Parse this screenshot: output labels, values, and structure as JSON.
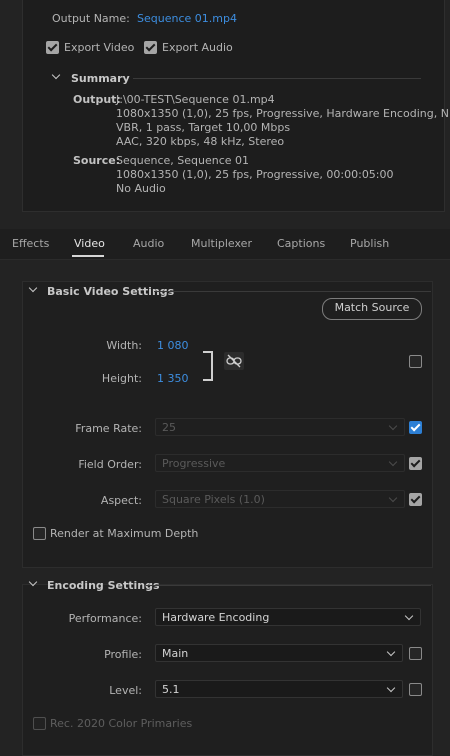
{
  "output": {
    "name_label": "Output Name:",
    "name_value": "Sequence 01.mp4",
    "export_video_label": "Export Video",
    "export_audio_label": "Export Audio",
    "export_video_checked": true,
    "export_audio_checked": true
  },
  "summary": {
    "title": "Summary",
    "output_label": "Output:",
    "output_lines": [
      "J:\\00-TEST\\Sequence 01.mp4",
      "1080x1350 (1,0), 25 fps, Progressive, Hardware Encoding, N...",
      "VBR, 1 pass, Target 10,00 Mbps",
      "AAC, 320 kbps, 48 kHz, Stereo"
    ],
    "source_label": "Source:",
    "source_lines": [
      "Sequence, Sequence 01",
      "1080x1350 (1,0), 25 fps, Progressive, 00:00:05:00",
      "No Audio"
    ]
  },
  "tabs": [
    "Effects",
    "Video",
    "Audio",
    "Multiplexer",
    "Captions",
    "Publish"
  ],
  "active_tab": "Video",
  "basic_video": {
    "title": "Basic Video Settings",
    "match_source_label": "Match Source",
    "width_label": "Width:",
    "width_value": "1 080",
    "height_label": "Height:",
    "height_value": "1 350",
    "frame_rate_label": "Frame Rate:",
    "frame_rate_value": "25",
    "field_order_label": "Field Order:",
    "field_order_value": "Progressive",
    "aspect_label": "Aspect:",
    "aspect_value": "Square Pixels (1.0)",
    "render_max_depth_label": "Render at Maximum Depth"
  },
  "encoding": {
    "title": "Encoding Settings",
    "performance_label": "Performance:",
    "performance_value": "Hardware Encoding",
    "profile_label": "Profile:",
    "profile_value": "Main",
    "level_label": "Level:",
    "level_value": "5.1",
    "rec2020_label": "Rec. 2020 Color Primaries"
  },
  "colors": {
    "accent": "#2d7fd4",
    "link": "#3d8ee0",
    "background": "#232323"
  }
}
